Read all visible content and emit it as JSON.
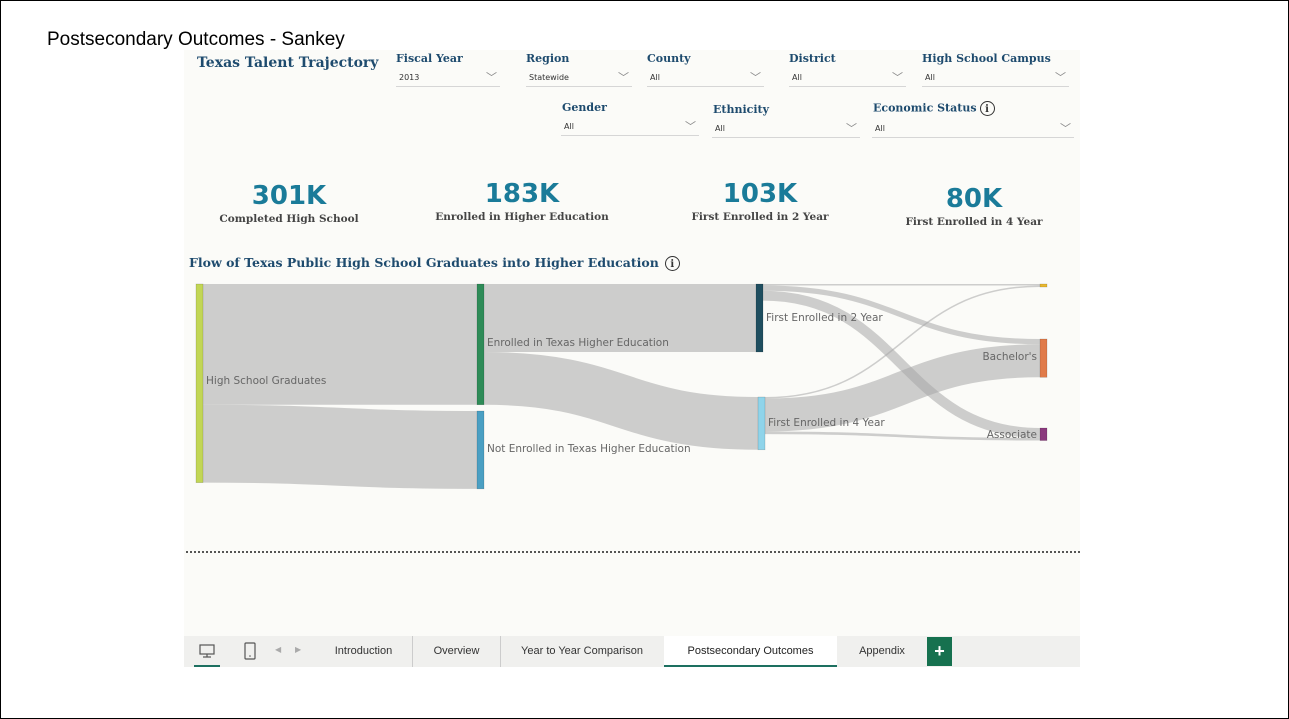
{
  "slide_title": "Postsecondary Outcomes - Sankey",
  "report_title": "Texas Talent Trajectory",
  "slicers": {
    "fiscal_year": {
      "label": "Fiscal Year",
      "value": "2013"
    },
    "region": {
      "label": "Region",
      "value": "Statewide"
    },
    "county": {
      "label": "County",
      "value": "All"
    },
    "district": {
      "label": "District",
      "value": "All"
    },
    "campus": {
      "label": "High School Campus",
      "value": "All"
    },
    "gender": {
      "label": "Gender",
      "value": "All"
    },
    "ethnicity": {
      "label": "Ethnicity",
      "value": "All"
    },
    "economic_status": {
      "label": "Economic Status",
      "value": "All"
    }
  },
  "info_glyph": "i",
  "kpis": [
    {
      "value": "301K",
      "label": "Completed High School"
    },
    {
      "value": "183K",
      "label": "Enrolled in Higher Education"
    },
    {
      "value": "103K",
      "label": "First Enrolled in 2 Year"
    },
    {
      "value": "80K",
      "label": "First Enrolled in 4 Year"
    }
  ],
  "chart_title": "Flow of Texas Public High School Graduates into Higher Education",
  "chart_data": {
    "type": "sankey",
    "nodes": [
      {
        "id": "hs",
        "label": "High School Graduates",
        "value": 301,
        "color": "#c2d655"
      },
      {
        "id": "enr",
        "label": "Enrolled in Texas Higher Education",
        "value": 183,
        "color": "#2e8b57"
      },
      {
        "id": "not",
        "label": "Not Enrolled in Texas Higher Education",
        "value": 118,
        "color": "#4a9fc3"
      },
      {
        "id": "two",
        "label": "First Enrolled in 2 Year",
        "value": 103,
        "color": "#1f4e5f"
      },
      {
        "id": "four",
        "label": "First Enrolled in 4 Year",
        "value": 80,
        "color": "#8fd4ea"
      },
      {
        "id": "top",
        "label": "",
        "value": 3,
        "color": "#e8b830"
      },
      {
        "id": "ba",
        "label": "Bachelor's",
        "value": 58,
        "color": "#e07b4a"
      },
      {
        "id": "as",
        "label": "Associate",
        "value": 19,
        "color": "#8b3a7e"
      }
    ],
    "links": [
      {
        "source": "hs",
        "target": "enr",
        "value": 183
      },
      {
        "source": "hs",
        "target": "not",
        "value": 118
      },
      {
        "source": "enr",
        "target": "two",
        "value": 103
      },
      {
        "source": "enr",
        "target": "four",
        "value": 80
      },
      {
        "source": "two",
        "target": "top",
        "value": 1
      },
      {
        "source": "two",
        "target": "ba",
        "value": 8
      },
      {
        "source": "two",
        "target": "as",
        "value": 15
      },
      {
        "source": "four",
        "target": "top",
        "value": 2
      },
      {
        "source": "four",
        "target": "ba",
        "value": 50
      },
      {
        "source": "four",
        "target": "as",
        "value": 4
      }
    ]
  },
  "tabs": [
    {
      "label": "Introduction"
    },
    {
      "label": "Overview"
    },
    {
      "label": "Year to Year Comparison"
    },
    {
      "label": "Postsecondary Outcomes",
      "active": true
    },
    {
      "label": "Appendix"
    }
  ],
  "add_glyph": "+",
  "icons": [
    "desktop-layout-icon",
    "mobile-layout-icon",
    "previous-page-icon",
    "next-page-icon",
    "info-icon",
    "chevron-down-icon",
    "add-page-icon"
  ]
}
